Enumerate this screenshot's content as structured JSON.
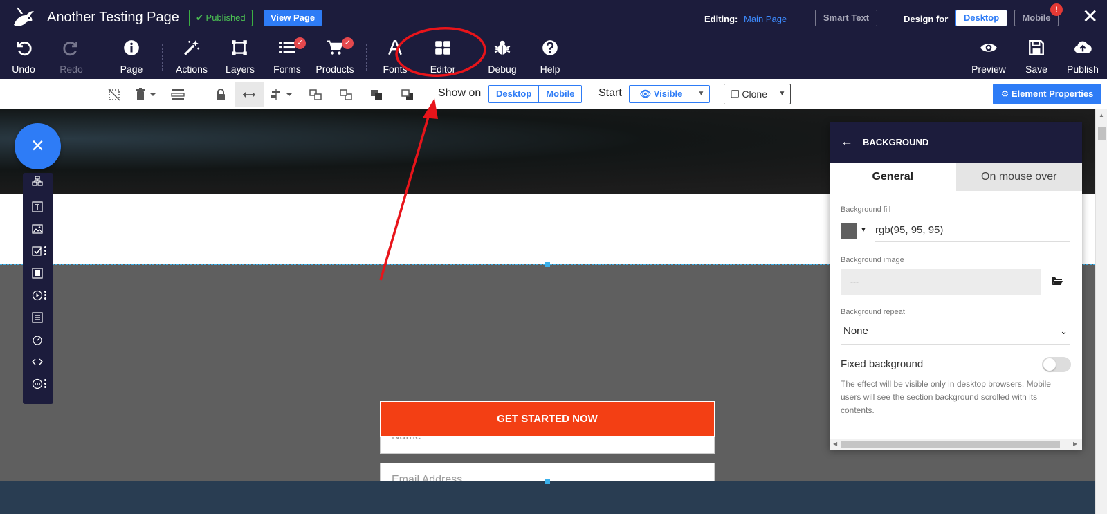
{
  "header": {
    "page_title": "Another Testing Page",
    "published_label": "Published",
    "view_page_label": "View Page",
    "editing_label": "Editing:",
    "editing_page": "Main Page",
    "smart_text_label": "Smart Text",
    "design_for_label": "Design for",
    "desktop_label": "Desktop",
    "mobile_label": "Mobile",
    "mobile_alert": "!"
  },
  "toolbar": {
    "undo": "Undo",
    "redo": "Redo",
    "page": "Page",
    "actions": "Actions",
    "layers": "Layers",
    "forms": "Forms",
    "products": "Products",
    "fonts": "Fonts",
    "editor": "Editor",
    "debug": "Debug",
    "help": "Help",
    "preview": "Preview",
    "save": "Save",
    "publish": "Publish"
  },
  "element_toolbar": {
    "show_on_label": "Show on",
    "show_on_desktop": "Desktop",
    "show_on_mobile": "Mobile",
    "start_label": "Start",
    "visible_label": "Visible",
    "clone_label": "Clone",
    "element_properties_label": "Element Properties"
  },
  "form": {
    "name_placeholder": "Name",
    "email_placeholder": "Email Address",
    "cta_label": "GET STARTED NOW"
  },
  "panel": {
    "title": "BACKGROUND",
    "tab_general": "General",
    "tab_mouse_over": "On mouse over",
    "background_fill_label": "Background fill",
    "background_fill_value": "rgb(95, 95, 95)",
    "background_image_label": "Background image",
    "background_image_value": "---",
    "background_repeat_label": "Background repeat",
    "background_repeat_value": "None",
    "fixed_background_label": "Fixed background",
    "fixed_background_note": "The effect will be visible only in desktop browsers. Mobile users will see the section background scrolled with its contents.",
    "fixed_background_on": false
  },
  "colors": {
    "topbar": "#1c1c3c",
    "accent": "#2e7cf6",
    "cta": "#f33f14",
    "section_fill": "#5f5f5f",
    "annotation": "#e8141a"
  }
}
